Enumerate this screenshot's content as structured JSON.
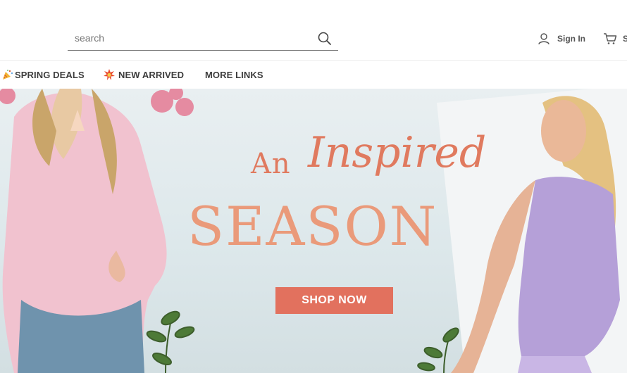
{
  "header": {
    "search": {
      "placeholder": "search",
      "value": ""
    },
    "sign_in_label": "Sign In",
    "cart_label": "S"
  },
  "nav": {
    "items": [
      {
        "label": "SPRING DEALS",
        "icon": "party-popper-icon"
      },
      {
        "label": "NEW ARRIVED",
        "icon": "sparkle-burst-icon"
      },
      {
        "label": "MORE LINKS"
      }
    ]
  },
  "banner": {
    "headline_prefix": "An",
    "headline_script": "Inspired",
    "headline_main": "SEASON",
    "cta_label": "SHOP NOW"
  },
  "colors": {
    "accent": "#e2715e",
    "headline": "#e07a5f",
    "banner_bg": "#e3ecee"
  }
}
